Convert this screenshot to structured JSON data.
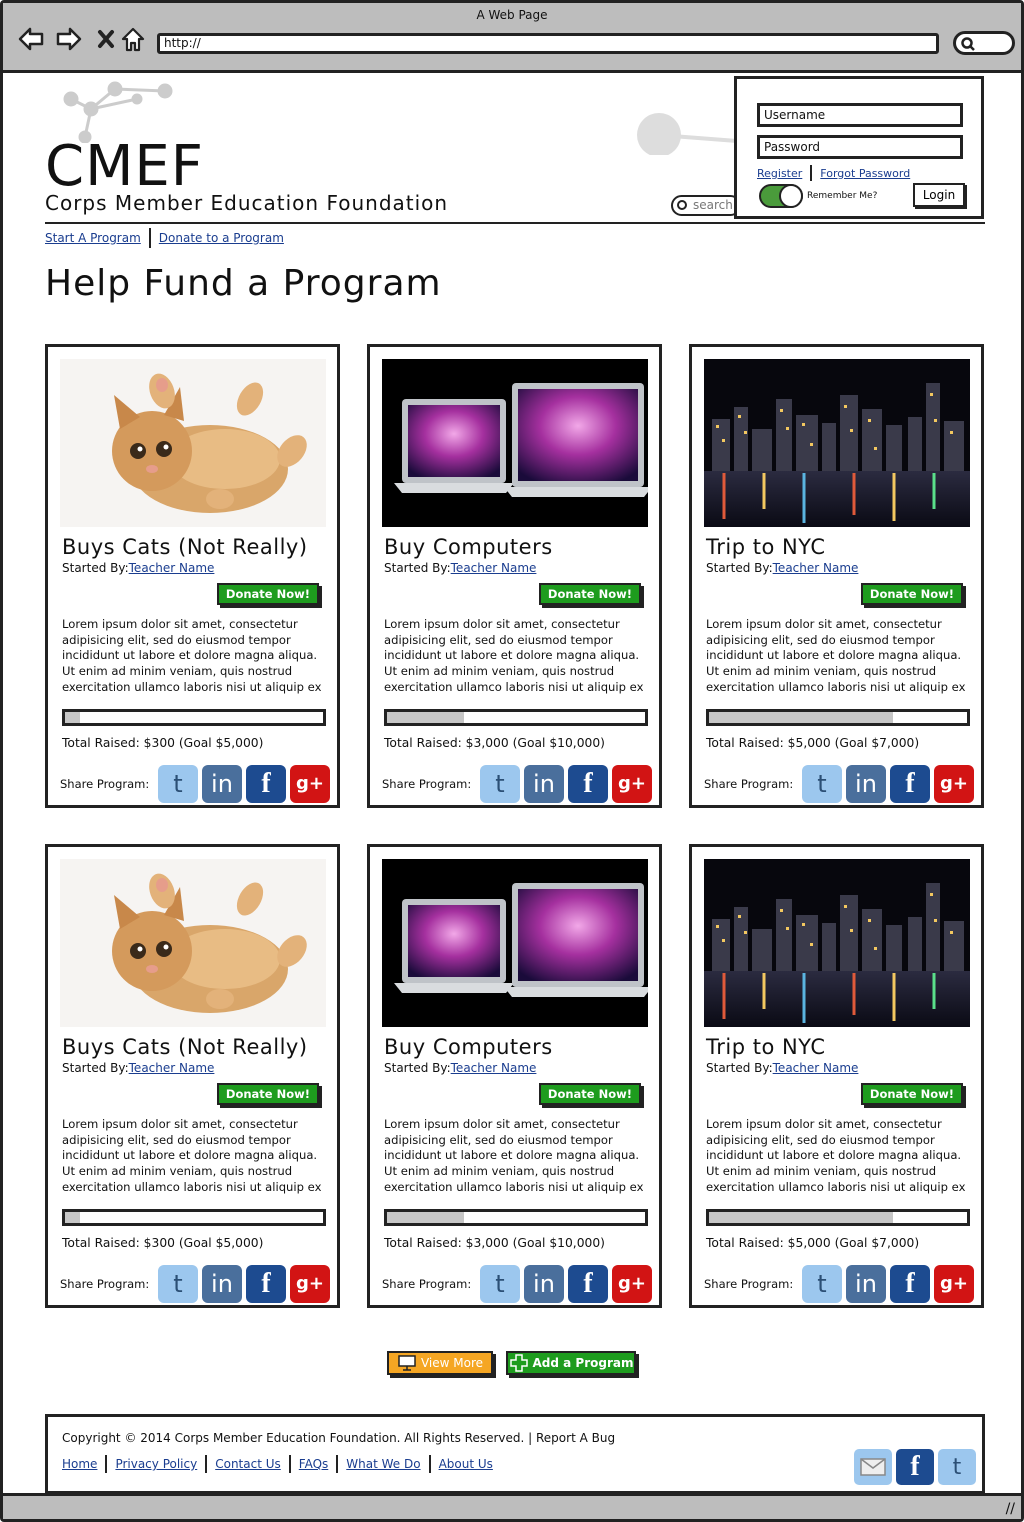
{
  "window": {
    "title": "A Web Page",
    "url": "http://"
  },
  "header": {
    "brand": "CMEF",
    "subtitle": "Corps Member Education Foundation",
    "search_placeholder": "search"
  },
  "login": {
    "username_placeholder": "Username",
    "password_placeholder": "Password",
    "register_link": "Register",
    "forgot_link": "Forgot Password",
    "remember_label": "Remember Me?",
    "remember_checked": true,
    "login_label": "Login"
  },
  "nav": {
    "items": [
      "Start A Program",
      "Donate to a Program"
    ]
  },
  "page": {
    "title": "Help Fund a Program"
  },
  "cards": [
    {
      "title": "Buys Cats (Not Really)",
      "started_label": "Started By:",
      "teacher": "Teacher Name",
      "donate": "Donate Now!",
      "desc": [
        "Lorem ipsum dolor sit amet, consectetur",
        "adipisicing elit, sed do eiusmod tempor",
        "incididunt ut labore et dolore magna aliqua.",
        "Ut enim ad minim veniam, quis nostrud",
        "exercitation ullamco laboris nisi ut aliquip ex"
      ],
      "progress": 0.06,
      "raised": "Total Raised: $300 (Goal $5,000)",
      "share_label": "Share Program:",
      "image": "cat-photo"
    },
    {
      "title": "Buy Computers",
      "started_label": "Started By:",
      "teacher": "Teacher Name",
      "donate": "Donate Now!",
      "desc": [
        "Lorem ipsum dolor sit amet, consectetur",
        "adipisicing elit, sed do eiusmod tempor",
        "incididunt ut labore et dolore magna aliqua.",
        "Ut enim ad minim veniam, quis nostrud",
        "exercitation ullamco laboris nisi ut aliquip ex"
      ],
      "progress": 0.3,
      "raised": "Total Raised: $3,000 (Goal $10,000)",
      "share_label": "Share Program:",
      "image": "laptops-photo"
    },
    {
      "title": "Trip to NYC",
      "started_label": "Started By:",
      "teacher": "Teacher Name",
      "donate": "Donate Now!",
      "desc": [
        "Lorem ipsum dolor sit amet, consectetur",
        "adipisicing elit, sed do eiusmod tempor",
        "incididunt ut labore et dolore magna aliqua.",
        "Ut enim ad minim veniam, quis nostrud",
        "exercitation ullamco laboris nisi ut aliquip ex"
      ],
      "progress": 0.714,
      "raised": "Total Raised: $5,000 (Goal $7,000)",
      "share_label": "Share Program:",
      "image": "nyc-skyline-photo"
    },
    {
      "title": "Buys Cats (Not Really)",
      "started_label": "Started By:",
      "teacher": "Teacher Name",
      "donate": "Donate Now!",
      "desc": [
        "Lorem ipsum dolor sit amet, consectetur",
        "adipisicing elit, sed do eiusmod tempor",
        "incididunt ut labore et dolore magna aliqua.",
        "Ut enim ad minim veniam, quis nostrud",
        "exercitation ullamco laboris nisi ut aliquip ex"
      ],
      "progress": 0.06,
      "raised": "Total Raised: $300 (Goal $5,000)",
      "share_label": "Share Program:",
      "image": "cat-photo"
    },
    {
      "title": "Buy Computers",
      "started_label": "Started By:",
      "teacher": "Teacher Name",
      "donate": "Donate Now!",
      "desc": [
        "Lorem ipsum dolor sit amet, consectetur",
        "adipisicing elit, sed do eiusmod tempor",
        "incididunt ut labore et dolore magna aliqua.",
        "Ut enim ad minim veniam, quis nostrud",
        "exercitation ullamco laboris nisi ut aliquip ex"
      ],
      "progress": 0.3,
      "raised": "Total Raised: $3,000 (Goal $10,000)",
      "share_label": "Share Program:",
      "image": "laptops-photo"
    },
    {
      "title": "Trip to NYC",
      "started_label": "Started By:",
      "teacher": "Teacher Name",
      "donate": "Donate Now!",
      "desc": [
        "Lorem ipsum dolor sit amet, consectetur",
        "adipisicing elit, sed do eiusmod tempor",
        "incididunt ut labore et dolore magna aliqua.",
        "Ut enim ad minim veniam, quis nostrud",
        "exercitation ullamco laboris nisi ut aliquip ex"
      ],
      "progress": 0.714,
      "raised": "Total Raised: $5,000 (Goal $7,000)",
      "share_label": "Share Program:",
      "image": "nyc-skyline-photo"
    }
  ],
  "share_icons": {
    "twitter": "t",
    "linkedin": "in",
    "facebook": "f",
    "google": "g+"
  },
  "actions": {
    "view_more": "View More",
    "add_program": "Add a Program"
  },
  "footer": {
    "copyright": "Copyright © 2014 Corps Member Education Foundation. All Rights Reserved. | Report A Bug",
    "links": [
      "Home",
      "Privacy Policy",
      "Contact Us",
      "FAQs",
      "What We Do",
      "About Us"
    ],
    "social": {
      "facebook": "f",
      "twitter": "t"
    }
  },
  "colors": {
    "donate_green": "#1e9c1e",
    "view_more_orange": "#f5a623",
    "link_blue": "#1a3d8f",
    "gplus_red": "#d21414",
    "facebook_blue": "#1d4b90"
  }
}
